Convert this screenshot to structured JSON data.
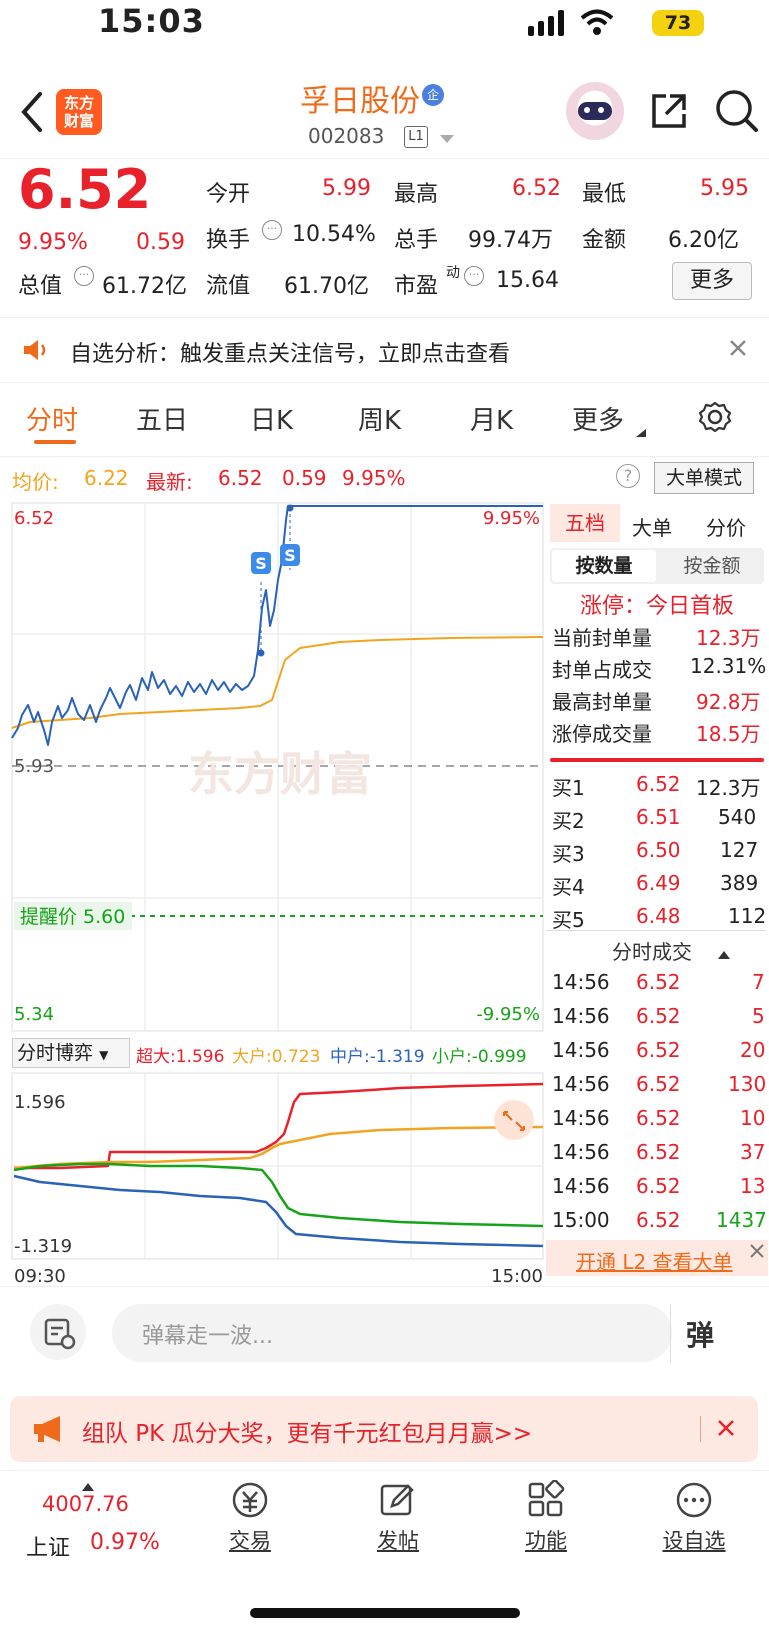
{
  "status_bar": {
    "time": "15:03",
    "battery": "73"
  },
  "header": {
    "logo_line1": "东方",
    "logo_line2": "财富",
    "stock_name": "孚日股份",
    "badge": "企",
    "stock_code": "002083",
    "level": "L1"
  },
  "quote": {
    "price": "6.52",
    "change_pct": "9.95%",
    "change": "0.59",
    "open_label": "今开",
    "open": "5.99",
    "high_label": "最高",
    "high": "6.52",
    "low_label": "最低",
    "low": "5.95",
    "turnover_label": "换手",
    "turnover": "10.54%",
    "volume_label": "总手",
    "volume": "99.74万",
    "amount_label": "金额",
    "amount": "6.20亿",
    "mktcap_label": "总值",
    "mktcap": "61.72亿",
    "float_label": "流值",
    "float_cap": "61.70亿",
    "pe_label": "市盈",
    "pe_sup": "动",
    "pe": "15.64",
    "more_button": "更多"
  },
  "notice": {
    "text": "自选分析：触发重点关注信号，立即点击查看"
  },
  "tabs": [
    "分时",
    "五日",
    "日K",
    "周K",
    "月K",
    "更多"
  ],
  "intraday": {
    "avg_label": "均价:",
    "avg_value": "6.22",
    "latest_label": "最新:",
    "latest_value": "6.52",
    "latest_change": "0.59",
    "latest_pct": "9.95%",
    "bigorder_button": "大单模式",
    "y_top": "6.52",
    "y_top_pct": "9.95%",
    "y_mid": "5.93",
    "alert_label": "提醒价 5.60",
    "y_bottom": "5.34",
    "y_bottom_pct": "-9.95%",
    "watermark": "东方财富",
    "signal": "S"
  },
  "flow": {
    "selector": "分时博弈",
    "super_label": "超大:1.596",
    "large_label": "大户:0.723",
    "mid_label": "中户:-1.319",
    "small_label": "小户:-0.999",
    "y_top": "1.596",
    "y_bottom": "-1.319",
    "x_start": "09:30",
    "x_end": "15:00"
  },
  "panel": {
    "tabs": [
      "五档",
      "大单",
      "分价"
    ],
    "sub_tabs": [
      "按数量",
      "按金额"
    ],
    "limit_status": "涨停：今日首板",
    "stats": [
      {
        "label": "当前封单量",
        "value": "12.3万"
      },
      {
        "label": "封单占成交",
        "value": "12.31%"
      },
      {
        "label": "最高封单量",
        "value": "92.8万"
      },
      {
        "label": "涨停成交量",
        "value": "18.5万"
      }
    ],
    "bids": [
      {
        "label": "买1",
        "price": "6.52",
        "qty": "12.3万"
      },
      {
        "label": "买2",
        "price": "6.51",
        "qty": "540"
      },
      {
        "label": "买3",
        "price": "6.50",
        "qty": "127"
      },
      {
        "label": "买4",
        "price": "6.49",
        "qty": "389"
      },
      {
        "label": "买5",
        "price": "6.48",
        "qty": "112"
      }
    ],
    "trades_title": "分时成交",
    "trades": [
      {
        "time": "14:56",
        "price": "6.52",
        "qty": "7"
      },
      {
        "time": "14:56",
        "price": "6.52",
        "qty": "5"
      },
      {
        "time": "14:56",
        "price": "6.52",
        "qty": "20"
      },
      {
        "time": "14:56",
        "price": "6.52",
        "qty": "130"
      },
      {
        "time": "14:56",
        "price": "6.52",
        "qty": "10"
      },
      {
        "time": "14:56",
        "price": "6.52",
        "qty": "37"
      },
      {
        "time": "14:56",
        "price": "6.52",
        "qty": "13"
      },
      {
        "time": "15:00",
        "price": "6.52",
        "qty": "1437"
      }
    ],
    "l2_link": "开通 L2 查看大单"
  },
  "comment": {
    "placeholder": "弹幕走一波...",
    "danmu_btn": "弹"
  },
  "promo": {
    "text": "组队 PK 瓜分大奖，更有千元红包月月赢>>"
  },
  "bottom_nav": {
    "index_value": "4007.76",
    "index_name": "上证",
    "index_pct": "0.97%",
    "items": [
      "交易",
      "发帖",
      "功能",
      "设自选"
    ]
  },
  "colors": {
    "up": "#e8212b",
    "down": "#17a317",
    "brand": "#f06a1b",
    "avg": "#f2a41e",
    "price_line": "#2a62b8"
  }
}
